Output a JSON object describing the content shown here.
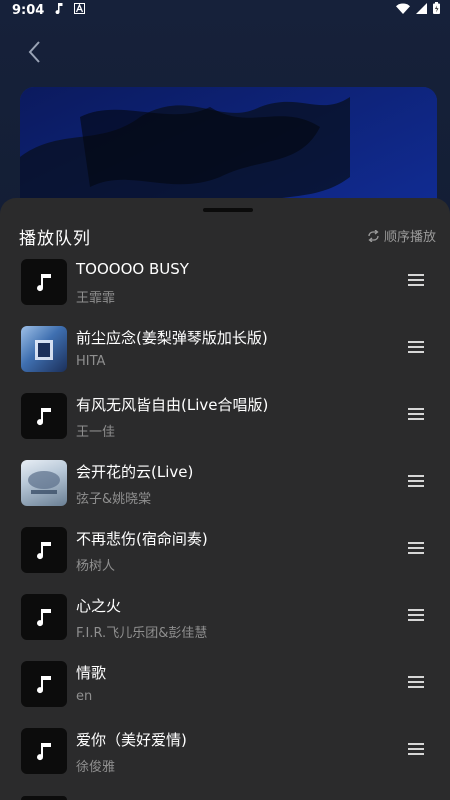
{
  "status_bar": {
    "time": "9:04"
  },
  "queue": {
    "title": "播放队列",
    "mode_label": "顺序播放",
    "songs": [
      {
        "title": "TOOOOO BUSY",
        "artist": "王霏霏",
        "thumb": "music-note"
      },
      {
        "title": "前尘应念(姜梨弹琴版加长版)",
        "artist": "HITA",
        "thumb": "album-art"
      },
      {
        "title": "有风无风皆自由(Live合唱版)",
        "artist": "王一佳",
        "thumb": "music-note"
      },
      {
        "title": "会开花的云(Live)",
        "artist": "弦子&姚晓棠",
        "thumb": "album-art"
      },
      {
        "title": "不再悲伤(宿命间奏)",
        "artist": "杨树人",
        "thumb": "music-note"
      },
      {
        "title": "心之火",
        "artist": "F.I.R.飞儿乐团&彭佳慧",
        "thumb": "music-note"
      },
      {
        "title": "情歌",
        "artist": "en",
        "thumb": "music-note"
      },
      {
        "title": "爱你（美好爱情)",
        "artist": "徐俊雅",
        "thumb": "music-note"
      }
    ]
  },
  "colors": {
    "sheet_bg": "#2b2b2c",
    "cover_blue": "#0e2a8a",
    "secondary_text": "#8f8f8f"
  }
}
